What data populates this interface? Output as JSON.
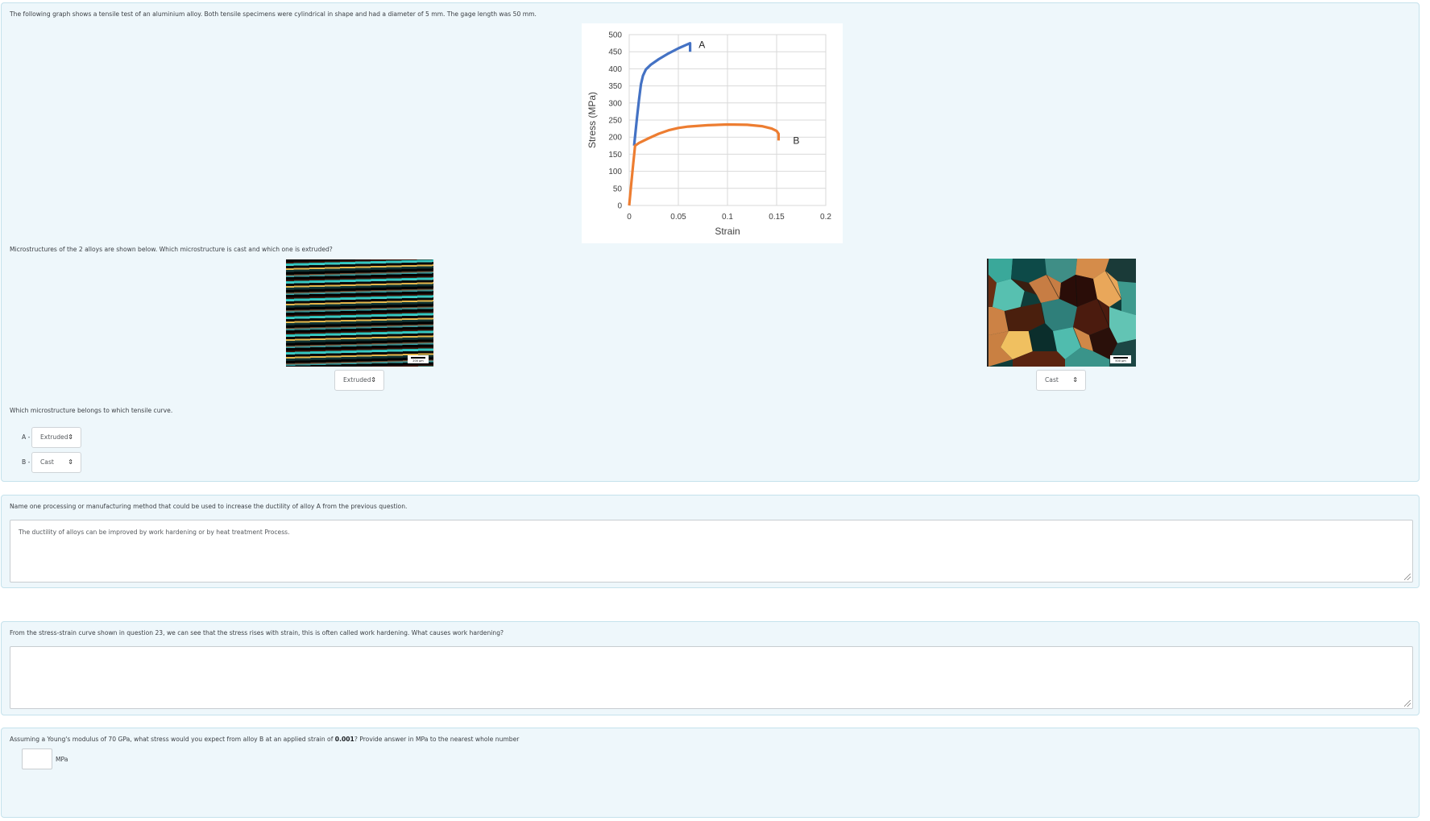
{
  "question1": {
    "intro": "The following graph shows a tensile test of an aluminium alloy. Both tensile specimens were cylindrical in shape and had a diameter of 5 mm. The gage length was 50 mm.",
    "micro_prompt": "Microstructures of the 2 alloys are shown below. Which microstructure is cast and which one is extruded?",
    "image1": {
      "alt": "extruded-microstructure",
      "scale_label": "200 µm",
      "selected": "Extruded"
    },
    "image2": {
      "alt": "cast-microstructure",
      "scale_label": "500 µm",
      "selected": "Cast"
    },
    "match_prompt": "Which microstructure belongs to which tensile curve.",
    "matches": [
      {
        "label": "A -",
        "selected": "Extruded"
      },
      {
        "label": "B -",
        "selected": "Cast"
      }
    ]
  },
  "question2": {
    "prompt": "Name one processing or manufacturing method that could be used to increase the ductility of alloy A from the previous question.",
    "answer": "The ductility of alloys can be improved by work hardening or by heat treatment Process."
  },
  "question3": {
    "prompt": "From the stress-strain curve shown in question 23, we can see that the stress rises with strain, this is often called work hardening. What causes work hardening?",
    "answer": ""
  },
  "question4": {
    "prompt_before": "Assuming a Young's modulus of 70 GPa, what stress would you expect from alloy B at an applied  strain of ",
    "prompt_bold": "0.001",
    "prompt_after": "? Provide answer in MPa to the nearest whole number",
    "answer": "",
    "unit": "MPa"
  },
  "chart_data": {
    "type": "line",
    "title": "",
    "xlabel": "Strain",
    "ylabel": "Stress (MPa)",
    "xlim": [
      0,
      0.2
    ],
    "ylim": [
      0,
      500
    ],
    "xticks": [
      "0",
      "0.05",
      "0.1",
      "0.15",
      "0.2"
    ],
    "yticks": [
      "0",
      "50",
      "100",
      "150",
      "200",
      "250",
      "300",
      "350",
      "400",
      "450",
      "500"
    ],
    "grid": true,
    "series": [
      {
        "name": "A",
        "color": "#4472c4",
        "points": [
          [
            0.005,
            175
          ],
          [
            0.008,
            260
          ],
          [
            0.01,
            310
          ],
          [
            0.012,
            355
          ],
          [
            0.014,
            380
          ],
          [
            0.017,
            398
          ],
          [
            0.022,
            412
          ],
          [
            0.03,
            428
          ],
          [
            0.04,
            445
          ],
          [
            0.05,
            460
          ],
          [
            0.058,
            470
          ],
          [
            0.062,
            475
          ],
          [
            0.062,
            450
          ]
        ]
      },
      {
        "name": "B",
        "color": "#ed7d31",
        "points": [
          [
            0,
            0
          ],
          [
            0.002,
            60
          ],
          [
            0.004,
            120
          ],
          [
            0.006,
            175
          ],
          [
            0.01,
            183
          ],
          [
            0.02,
            197
          ],
          [
            0.03,
            210
          ],
          [
            0.04,
            220
          ],
          [
            0.05,
            227
          ],
          [
            0.06,
            231
          ],
          [
            0.08,
            235
          ],
          [
            0.1,
            237
          ],
          [
            0.12,
            236
          ],
          [
            0.135,
            232
          ],
          [
            0.145,
            225
          ],
          [
            0.15,
            218
          ],
          [
            0.152,
            210
          ],
          [
            0.152,
            190
          ]
        ]
      }
    ],
    "annotations": [
      {
        "text": "A",
        "x": 0.074,
        "y": 470
      },
      {
        "text": "B",
        "x": 0.17,
        "y": 190
      }
    ]
  }
}
